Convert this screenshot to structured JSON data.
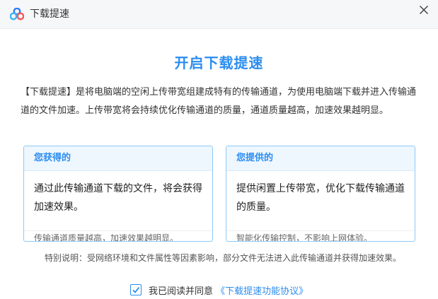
{
  "window": {
    "title": "下载提速",
    "close_glyph": "✕",
    "logo_icon": "baidu-netdisk-cloud-icon"
  },
  "main": {
    "heading": "开启下载提速",
    "description": "【下载提速】是将电脑端的空闲上传带宽组建成特有的传输通道，为使用电脑端下载并进入传输通道的文件加速。上传带宽将会持续优化传输通道的质量，通道质量越高，加速效果越明显。"
  },
  "cards": {
    "gain": {
      "title": "您获得的",
      "body": "通过此传输通道下载的文件，将会获得加速效果。",
      "foot": "传输通道质量越高，加速效果越明显。"
    },
    "provide": {
      "title": "您提供的",
      "body": "提供闲置上传带宽，优化下载传输通道的质量。",
      "foot": "智能化传输控制，不影响上网体验。"
    }
  },
  "note": "特别说明：受网络环境和文件属性等因素影响，部分文件无法进入此传输通道并获得加速效果。",
  "agreement": {
    "checked": true,
    "prefix": "我已阅读并同意",
    "link": "《下载提速功能协议》"
  },
  "colors": {
    "accent": "#2b8df0",
    "card_border": "#8dcaf5",
    "titlebar_bg": "#f6f7f9"
  }
}
